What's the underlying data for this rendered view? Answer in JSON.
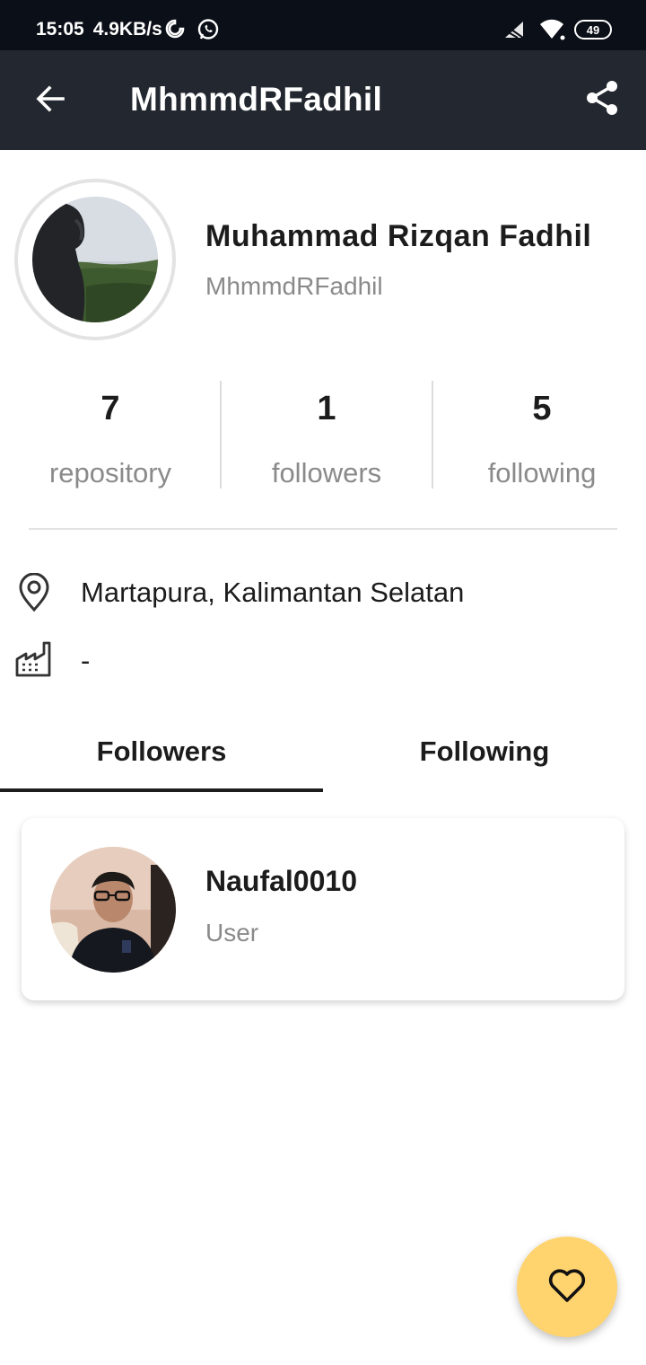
{
  "status_bar": {
    "time": "15:05",
    "net_speed": "4.9KB/s",
    "battery": "49",
    "icons": [
      "data-saver-icon",
      "whatsapp-icon",
      "signal-icon",
      "wifi-icon",
      "battery-icon"
    ]
  },
  "app_bar": {
    "title": "MhmmdRFadhil",
    "back_icon": "arrow-left-icon",
    "share_icon": "share-icon",
    "background": "#232830"
  },
  "profile": {
    "name": "Muhammad Rizqan Fadhil",
    "username": "MhmmdRFadhil",
    "stats": [
      {
        "value": "7",
        "label": "repository"
      },
      {
        "value": "1",
        "label": "followers"
      },
      {
        "value": "5",
        "label": "following"
      }
    ],
    "location": "Martapura, Kalimantan Selatan",
    "company": "-"
  },
  "tabs": [
    {
      "label": "Followers",
      "active": true
    },
    {
      "label": "Following",
      "active": false
    }
  ],
  "followers": [
    {
      "login": "Naufal0010",
      "type": "User"
    }
  ],
  "fab": {
    "icon": "heart-outline-icon",
    "color": "#ffd36e"
  }
}
